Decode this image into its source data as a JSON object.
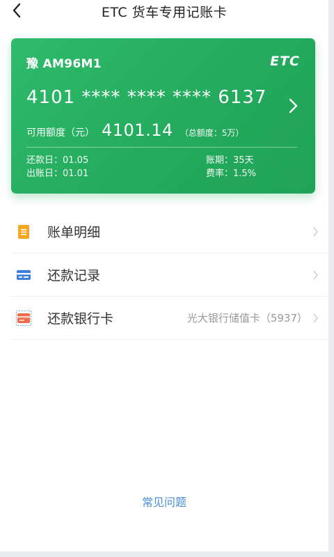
{
  "nav": {
    "title": "ETC 货车专用记账卡",
    "back_icon": "back-arrow-icon"
  },
  "card": {
    "plate": "豫 AM96M1",
    "logo_text": "ETC",
    "number": "4101 **** **** **** 6137",
    "credit_label": "可用额度（元）",
    "credit_amount": "4101.14",
    "credit_total": "（总额度：5万）",
    "repay_date": "还款日：01.05",
    "bill_date": "出账日：01.01",
    "period": "账期：35天",
    "rate": "费率：1.5%",
    "colors": {
      "gradient_start": "#2fba6b",
      "gradient_end": "#1fa357"
    }
  },
  "menu": [
    {
      "label": "账单明细",
      "value": "",
      "icon": "bill-detail-icon",
      "icon_color": "#f5a623"
    },
    {
      "label": "还款记录",
      "value": "",
      "icon": "repayment-record-icon",
      "icon_color": "#3b7ee0"
    },
    {
      "label": "还款银行卡",
      "value": "光大银行储值卡（5937）",
      "icon": "bank-card-icon",
      "icon_color": "#f06a4a"
    }
  ],
  "faq": "常见问题"
}
